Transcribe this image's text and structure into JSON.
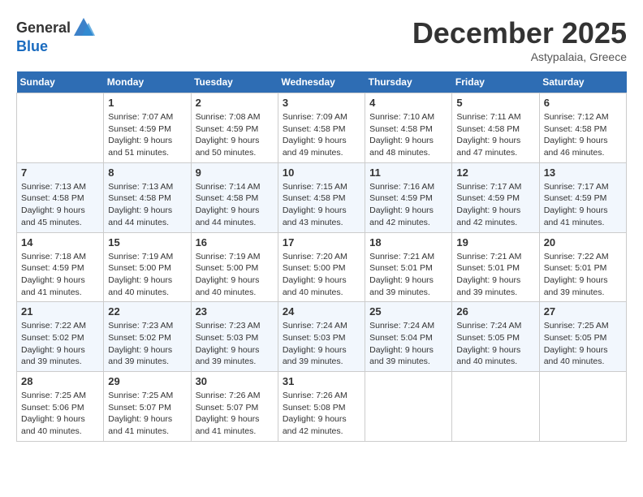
{
  "header": {
    "logo": {
      "general": "General",
      "blue": "Blue"
    },
    "month": "December 2025",
    "location": "Astypalaia, Greece"
  },
  "weekdays": [
    "Sunday",
    "Monday",
    "Tuesday",
    "Wednesday",
    "Thursday",
    "Friday",
    "Saturday"
  ],
  "weeks": [
    [
      {
        "day": "",
        "info": ""
      },
      {
        "day": "1",
        "info": "Sunrise: 7:07 AM\nSunset: 4:59 PM\nDaylight: 9 hours\nand 51 minutes."
      },
      {
        "day": "2",
        "info": "Sunrise: 7:08 AM\nSunset: 4:59 PM\nDaylight: 9 hours\nand 50 minutes."
      },
      {
        "day": "3",
        "info": "Sunrise: 7:09 AM\nSunset: 4:58 PM\nDaylight: 9 hours\nand 49 minutes."
      },
      {
        "day": "4",
        "info": "Sunrise: 7:10 AM\nSunset: 4:58 PM\nDaylight: 9 hours\nand 48 minutes."
      },
      {
        "day": "5",
        "info": "Sunrise: 7:11 AM\nSunset: 4:58 PM\nDaylight: 9 hours\nand 47 minutes."
      },
      {
        "day": "6",
        "info": "Sunrise: 7:12 AM\nSunset: 4:58 PM\nDaylight: 9 hours\nand 46 minutes."
      }
    ],
    [
      {
        "day": "7",
        "info": "Sunrise: 7:13 AM\nSunset: 4:58 PM\nDaylight: 9 hours\nand 45 minutes."
      },
      {
        "day": "8",
        "info": "Sunrise: 7:13 AM\nSunset: 4:58 PM\nDaylight: 9 hours\nand 44 minutes."
      },
      {
        "day": "9",
        "info": "Sunrise: 7:14 AM\nSunset: 4:58 PM\nDaylight: 9 hours\nand 44 minutes."
      },
      {
        "day": "10",
        "info": "Sunrise: 7:15 AM\nSunset: 4:58 PM\nDaylight: 9 hours\nand 43 minutes."
      },
      {
        "day": "11",
        "info": "Sunrise: 7:16 AM\nSunset: 4:59 PM\nDaylight: 9 hours\nand 42 minutes."
      },
      {
        "day": "12",
        "info": "Sunrise: 7:17 AM\nSunset: 4:59 PM\nDaylight: 9 hours\nand 42 minutes."
      },
      {
        "day": "13",
        "info": "Sunrise: 7:17 AM\nSunset: 4:59 PM\nDaylight: 9 hours\nand 41 minutes."
      }
    ],
    [
      {
        "day": "14",
        "info": "Sunrise: 7:18 AM\nSunset: 4:59 PM\nDaylight: 9 hours\nand 41 minutes."
      },
      {
        "day": "15",
        "info": "Sunrise: 7:19 AM\nSunset: 5:00 PM\nDaylight: 9 hours\nand 40 minutes."
      },
      {
        "day": "16",
        "info": "Sunrise: 7:19 AM\nSunset: 5:00 PM\nDaylight: 9 hours\nand 40 minutes."
      },
      {
        "day": "17",
        "info": "Sunrise: 7:20 AM\nSunset: 5:00 PM\nDaylight: 9 hours\nand 40 minutes."
      },
      {
        "day": "18",
        "info": "Sunrise: 7:21 AM\nSunset: 5:01 PM\nDaylight: 9 hours\nand 39 minutes."
      },
      {
        "day": "19",
        "info": "Sunrise: 7:21 AM\nSunset: 5:01 PM\nDaylight: 9 hours\nand 39 minutes."
      },
      {
        "day": "20",
        "info": "Sunrise: 7:22 AM\nSunset: 5:01 PM\nDaylight: 9 hours\nand 39 minutes."
      }
    ],
    [
      {
        "day": "21",
        "info": "Sunrise: 7:22 AM\nSunset: 5:02 PM\nDaylight: 9 hours\nand 39 minutes."
      },
      {
        "day": "22",
        "info": "Sunrise: 7:23 AM\nSunset: 5:02 PM\nDaylight: 9 hours\nand 39 minutes."
      },
      {
        "day": "23",
        "info": "Sunrise: 7:23 AM\nSunset: 5:03 PM\nDaylight: 9 hours\nand 39 minutes."
      },
      {
        "day": "24",
        "info": "Sunrise: 7:24 AM\nSunset: 5:03 PM\nDaylight: 9 hours\nand 39 minutes."
      },
      {
        "day": "25",
        "info": "Sunrise: 7:24 AM\nSunset: 5:04 PM\nDaylight: 9 hours\nand 39 minutes."
      },
      {
        "day": "26",
        "info": "Sunrise: 7:24 AM\nSunset: 5:05 PM\nDaylight: 9 hours\nand 40 minutes."
      },
      {
        "day": "27",
        "info": "Sunrise: 7:25 AM\nSunset: 5:05 PM\nDaylight: 9 hours\nand 40 minutes."
      }
    ],
    [
      {
        "day": "28",
        "info": "Sunrise: 7:25 AM\nSunset: 5:06 PM\nDaylight: 9 hours\nand 40 minutes."
      },
      {
        "day": "29",
        "info": "Sunrise: 7:25 AM\nSunset: 5:07 PM\nDaylight: 9 hours\nand 41 minutes."
      },
      {
        "day": "30",
        "info": "Sunrise: 7:26 AM\nSunset: 5:07 PM\nDaylight: 9 hours\nand 41 minutes."
      },
      {
        "day": "31",
        "info": "Sunrise: 7:26 AM\nSunset: 5:08 PM\nDaylight: 9 hours\nand 42 minutes."
      },
      {
        "day": "",
        "info": ""
      },
      {
        "day": "",
        "info": ""
      },
      {
        "day": "",
        "info": ""
      }
    ]
  ]
}
